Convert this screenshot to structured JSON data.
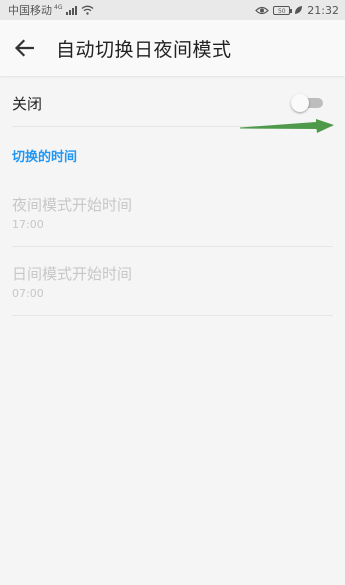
{
  "status_bar": {
    "carrier": "中国移动",
    "network": "4G",
    "battery": "50",
    "time": "21:32"
  },
  "toolbar": {
    "title": "自动切换日夜间模式"
  },
  "toggle_row": {
    "label": "关闭",
    "switch_on": false
  },
  "section": {
    "header": "切换的时间"
  },
  "time_items": [
    {
      "title": "夜间模式开始时间",
      "value": "17:00"
    },
    {
      "title": "日间模式开始时间",
      "value": "07:00"
    }
  ],
  "colors": {
    "accent": "#2196f3",
    "annotation_arrow": "#4e9a4a",
    "disabled_text": "#c7c7c7"
  },
  "icons": [
    "back-arrow-icon",
    "wifi-icon",
    "eye-icon",
    "leaf-icon",
    "signal-icon",
    "battery-icon"
  ]
}
